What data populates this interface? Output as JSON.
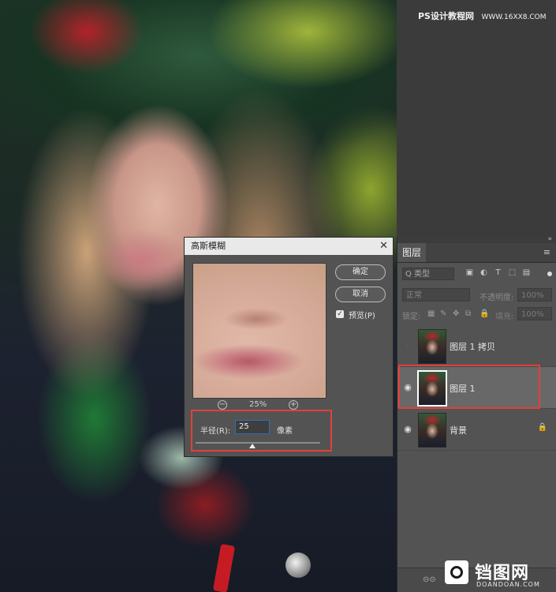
{
  "watermark_top": {
    "brand": "PS设计教程网",
    "url": "WWW.16XX8.COM"
  },
  "layers_panel": {
    "tab": "图层",
    "menu_icon": "≡",
    "kind_filter": "Q 类型",
    "blend_mode": "正常",
    "opacity_label": "不透明度:",
    "opacity_value": "100%",
    "lock_label": "锁定:",
    "fill_label": "填充:",
    "fill_value": "100%",
    "layers": [
      {
        "name": "图层 1 拷贝",
        "visible": false,
        "selected": false,
        "locked": false
      },
      {
        "name": "图层 1",
        "visible": true,
        "selected": true,
        "locked": false
      },
      {
        "name": "背景",
        "visible": true,
        "selected": false,
        "locked": true
      }
    ]
  },
  "dialog": {
    "title": "高斯模糊",
    "close": "✕",
    "ok_label": "确定",
    "cancel_label": "取消",
    "preview_label": "预览(P)",
    "preview_checked": true,
    "zoom_value": "25%",
    "radius_label": "半径(R):",
    "radius_value": "25",
    "radius_unit": "像素"
  },
  "watermark_bottom": {
    "cn": "铛图网",
    "en": "DOANDOAN.COM"
  },
  "colors": {
    "highlight": "#e2403b",
    "panel": "#535353",
    "focus": "#2e6fba"
  }
}
